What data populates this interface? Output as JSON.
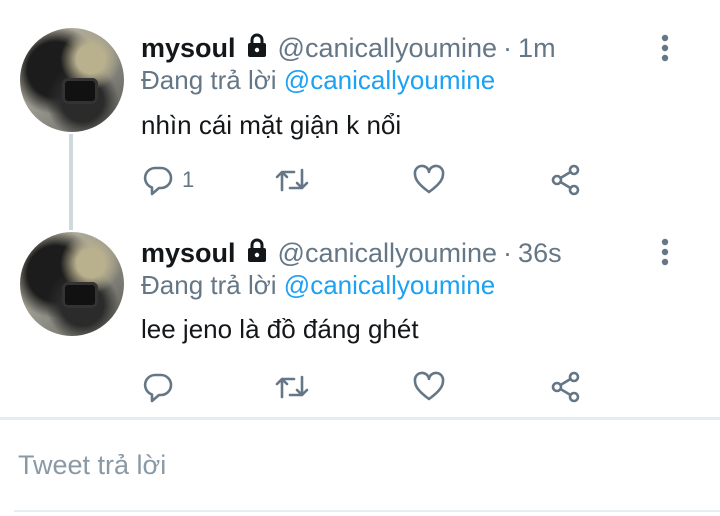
{
  "tweets": [
    {
      "display_name": "mysoul",
      "handle": "@canicallyoumine",
      "separator": "·",
      "time": "1m",
      "replying_prefix": "Đang trả lời",
      "replying_to": "@canicallyoumine",
      "text": "nhìn cái mặt giận k nổi",
      "reply_count": "1"
    },
    {
      "display_name": "mysoul",
      "handle": "@canicallyoumine",
      "separator": "·",
      "time": "36s",
      "replying_prefix": "Đang trả lời",
      "replying_to": "@canicallyoumine",
      "text": "lee jeno là đồ đáng ghét",
      "reply_count": ""
    }
  ],
  "compose": {
    "placeholder": "Tweet trả lời"
  },
  "icons": {
    "lock": "lock-icon",
    "more": "more-vertical-icon",
    "reply": "reply-icon",
    "retweet": "retweet-icon",
    "like": "heart-icon",
    "share": "share-icon"
  },
  "colors": {
    "mention": "#1da1f2",
    "secondary_text": "#657786",
    "icon": "#657786"
  }
}
